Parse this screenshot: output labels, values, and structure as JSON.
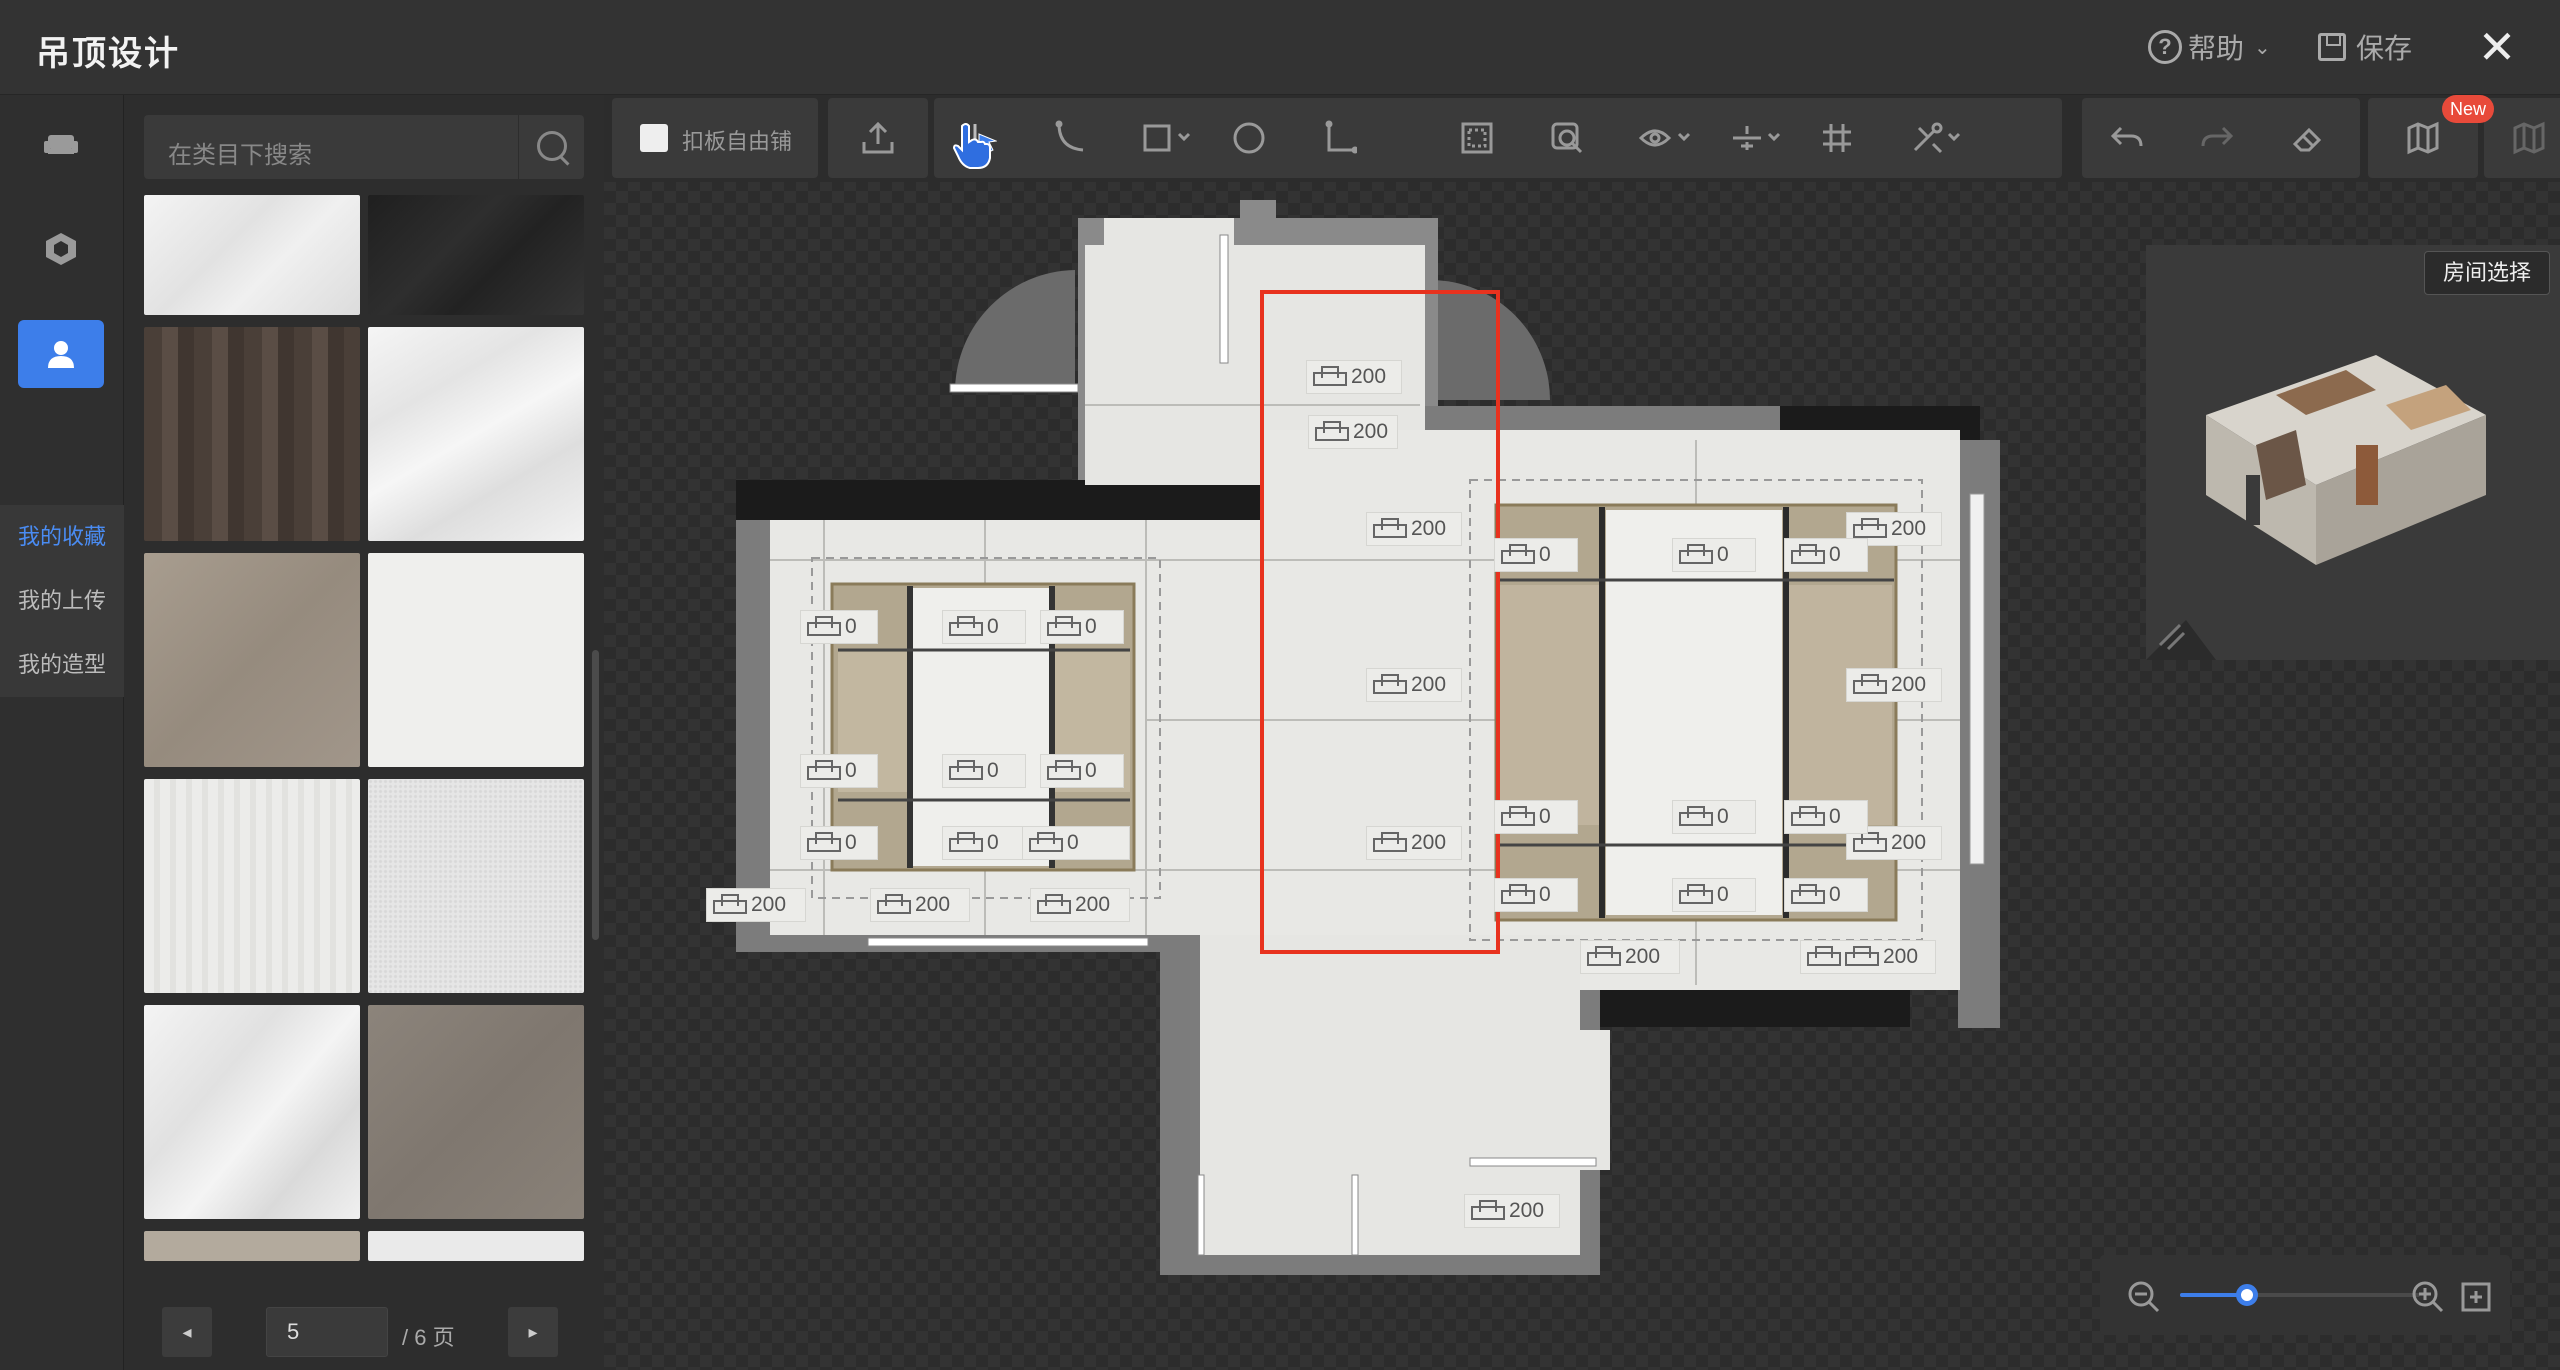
{
  "app": {
    "title": "吊顶设计"
  },
  "header": {
    "help_label": "帮助",
    "save_label": "保存"
  },
  "sidebar": {
    "tabs": [
      {
        "label": "我的收藏",
        "active": true
      },
      {
        "label": "我的上传",
        "active": false
      },
      {
        "label": "我的造型",
        "active": false
      }
    ]
  },
  "materials": {
    "search_placeholder": "在类目下搜索",
    "pager": {
      "current_page": "5",
      "total_label": "/ 6 页"
    }
  },
  "toolbar": {
    "free_tile_label": "扣板自由铺",
    "new_badge": "New"
  },
  "canvas": {
    "tag_prefix": "凸出",
    "tags": [
      "200",
      "200",
      "200",
      "200",
      "200",
      "200",
      "200",
      "200",
      "200",
      "200",
      "200",
      "200",
      "200",
      "200",
      "200",
      "0",
      "0",
      "0",
      "0",
      "0",
      "0",
      "0",
      "0",
      "0",
      "0",
      "0",
      "0",
      "0",
      "0",
      "0",
      "0",
      "0",
      "0",
      "0",
      "0",
      "0"
    ]
  },
  "minimap": {
    "room_select_label": "房间选择"
  },
  "colors": {
    "accent": "#3d7eea",
    "highlight": "#e8321e",
    "badge": "#e84a3a"
  }
}
